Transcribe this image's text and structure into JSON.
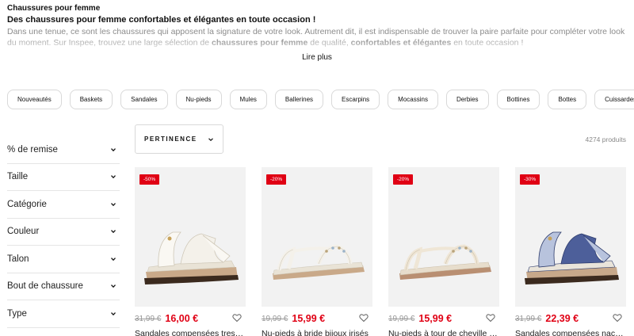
{
  "intro": {
    "title": "Chaussures pour femme",
    "headline": "Des chaussures pour femme confortables et élégantes en toute occasion !",
    "desc_1": "Dans une tenue, ce sont les chaussures qui apposent la signature de votre look. Autrement dit, il est indispensable de trouver la paire parfaite pour compléter votre look du moment. Sur Inspee, trouvez une large sélection de ",
    "desc_bold_1": "chaussures pour femme",
    "desc_2": " de qualité, ",
    "desc_bold_2": "confortables et élégantes",
    "desc_3": " en toute occasion !",
    "read_more": "Lire plus"
  },
  "chips": [
    "Nouveautés",
    "Baskets",
    "Sandales",
    "Nu-pieds",
    "Mules",
    "Ballerines",
    "Escarpins",
    "Mocassins",
    "Derbies",
    "Bottines",
    "Bottes",
    "Cuissardes"
  ],
  "filters": [
    "% de remise",
    "Taille",
    "Catégorie",
    "Couleur",
    "Talon",
    "Bout de chaussure",
    "Type"
  ],
  "sort": {
    "label": "PERTINENCE"
  },
  "count": "4274 produits",
  "products": [
    {
      "badge": "-50%",
      "old_price": "31,99 €",
      "price": "16,00 €",
      "name": "Sandales compensées tressées",
      "style": "wedge-white"
    },
    {
      "badge": "-20%",
      "old_price": "19,99 €",
      "price": "15,99 €",
      "name": "Nu-pieds à bride bijoux irisés",
      "style": "flat-white"
    },
    {
      "badge": "-20%",
      "old_price": "19,99 €",
      "price": "15,99 €",
      "name": "Nu-pieds à tour de cheville élastique",
      "style": "flat-beige"
    },
    {
      "badge": "-30%",
      "old_price": "31,99 €",
      "price": "22,39 €",
      "name": "Sandales compensées nacrées",
      "style": "wedge-blue"
    }
  ],
  "colors": {
    "accent": "#e00014",
    "border": "#d9d9d9",
    "image_bg": "#f2f2f2"
  }
}
